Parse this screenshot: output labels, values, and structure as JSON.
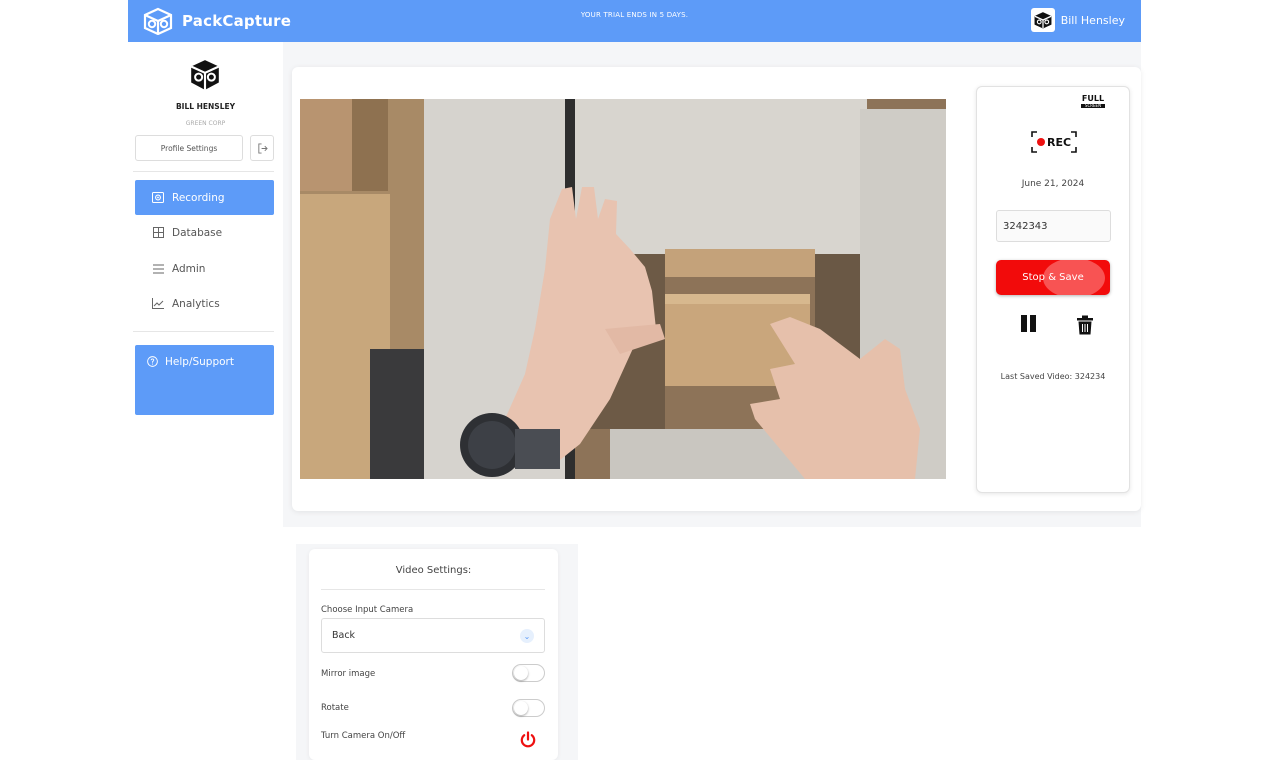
{
  "topbar": {
    "brand": "PackCapture",
    "trial_notice": "YOUR TRIAL ENDS  IN 5 DAYS.",
    "user_name": "Bill Hensley"
  },
  "sidebar": {
    "name": "BILL HENSLEY",
    "company": "GREEN CORP",
    "profile_settings": "Profile Settings",
    "items": [
      {
        "label": "Recording",
        "icon": "record-icon",
        "active": true
      },
      {
        "label": "Database",
        "icon": "grid-icon",
        "active": false
      },
      {
        "label": "Admin",
        "icon": "menu-icon",
        "active": false
      },
      {
        "label": "Analytics",
        "icon": "chart-icon",
        "active": false
      }
    ],
    "help": "Help/Support"
  },
  "recorder": {
    "fullscreen_top": "FULL",
    "fullscreen_bottom": "SCREEN",
    "rec_label": "REC",
    "date": "June 21, 2024",
    "order_value": "3242343",
    "stop_save": "Stop & Save",
    "last_saved": "Last Saved Video: 324234"
  },
  "video_settings": {
    "title": "Video Settings:",
    "camera_label": "Choose Input Camera",
    "camera_value": "Back",
    "mirror_label": "Mirror image",
    "mirror_on": false,
    "rotate_label": "Rotate",
    "rotate_on": false,
    "camera_toggle_label": "Turn Camera On/Off"
  },
  "colors": {
    "accent": "#5d9bf8",
    "record_red": "#f20b0b"
  }
}
